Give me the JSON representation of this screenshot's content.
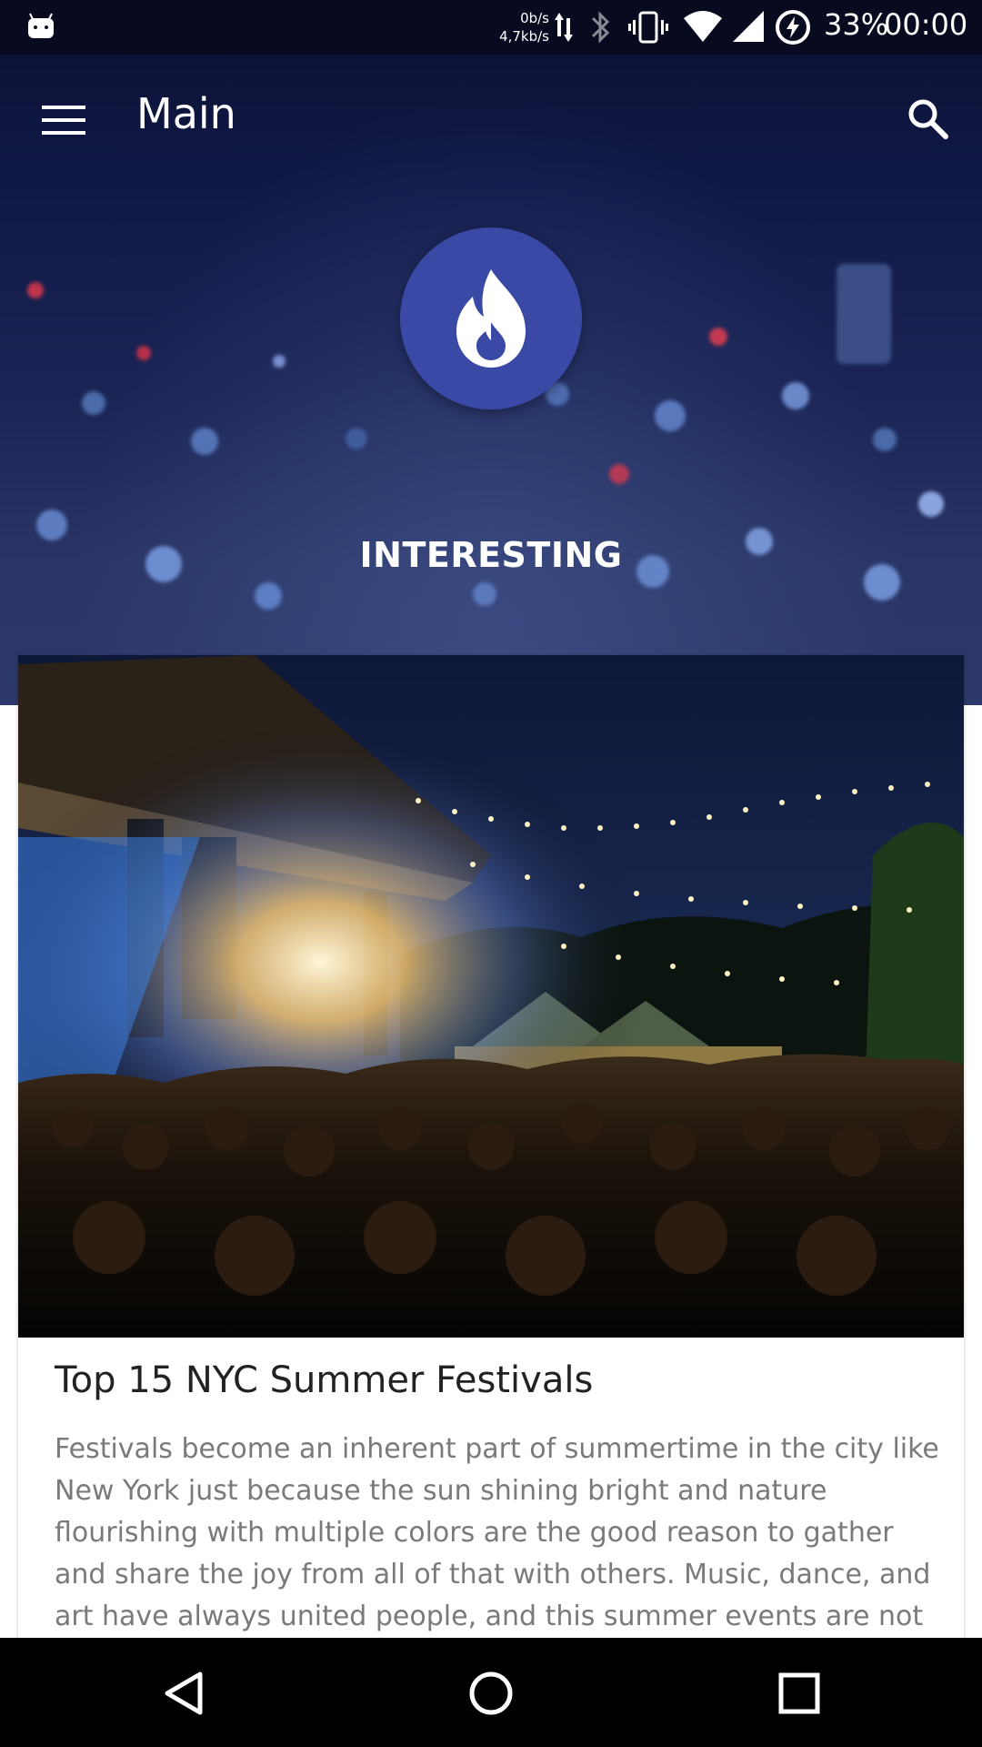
{
  "status_bar": {
    "net_up": "0b/s",
    "net_down": "4,7kb/s",
    "battery_percent": "33%",
    "time": "00:00"
  },
  "app_bar": {
    "title": "Main",
    "menu_icon": "menu-icon",
    "search_icon": "search-icon"
  },
  "category": {
    "icon": "flame-icon",
    "label": "INTERESTING",
    "badge_color": "#3a48a6"
  },
  "article": {
    "title": "Top 15 NYC Summer Festivals",
    "excerpt": "Festivals become an inherent part of summertime in the city like New York just because the sun shining bright and nature flourishing with multiple colors are the good reason to gather and share the joy from all of that with others. Music, dance, and art have always united people, and this summer events are not"
  },
  "nav_bar": {
    "back_icon": "back-icon",
    "home_icon": "home-icon",
    "recents_icon": "recents-icon"
  }
}
